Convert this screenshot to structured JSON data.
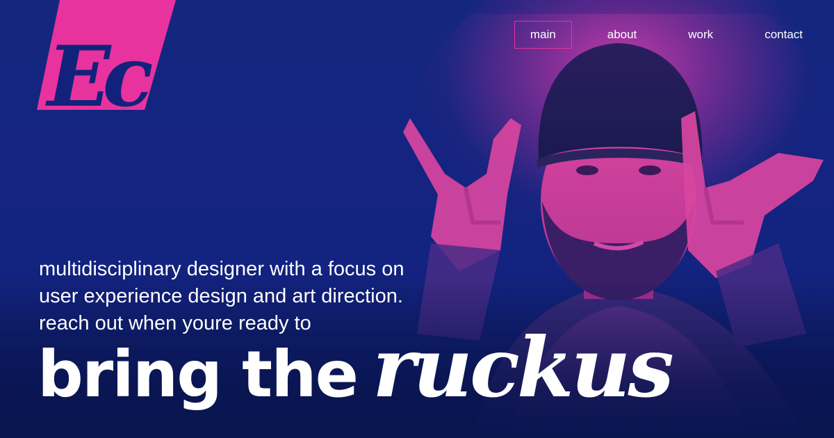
{
  "logo": {
    "text": "Ec",
    "accent_color": "#e8339e"
  },
  "nav": {
    "items": [
      {
        "label": "main",
        "active": true
      },
      {
        "label": "about",
        "active": false
      },
      {
        "label": "work",
        "active": false
      },
      {
        "label": "contact",
        "active": false
      }
    ]
  },
  "hero": {
    "tagline_lines": [
      "multidisciplinary designer with a focus on",
      "user experience design and art direction.",
      "reach out when youre ready to"
    ],
    "headline_bold": "bring the",
    "headline_script": "ruckus",
    "photo_description_icon": "portrait-photo"
  },
  "colors": {
    "background": "#12227a",
    "accent": "#e8339e",
    "text": "#ffffff"
  }
}
